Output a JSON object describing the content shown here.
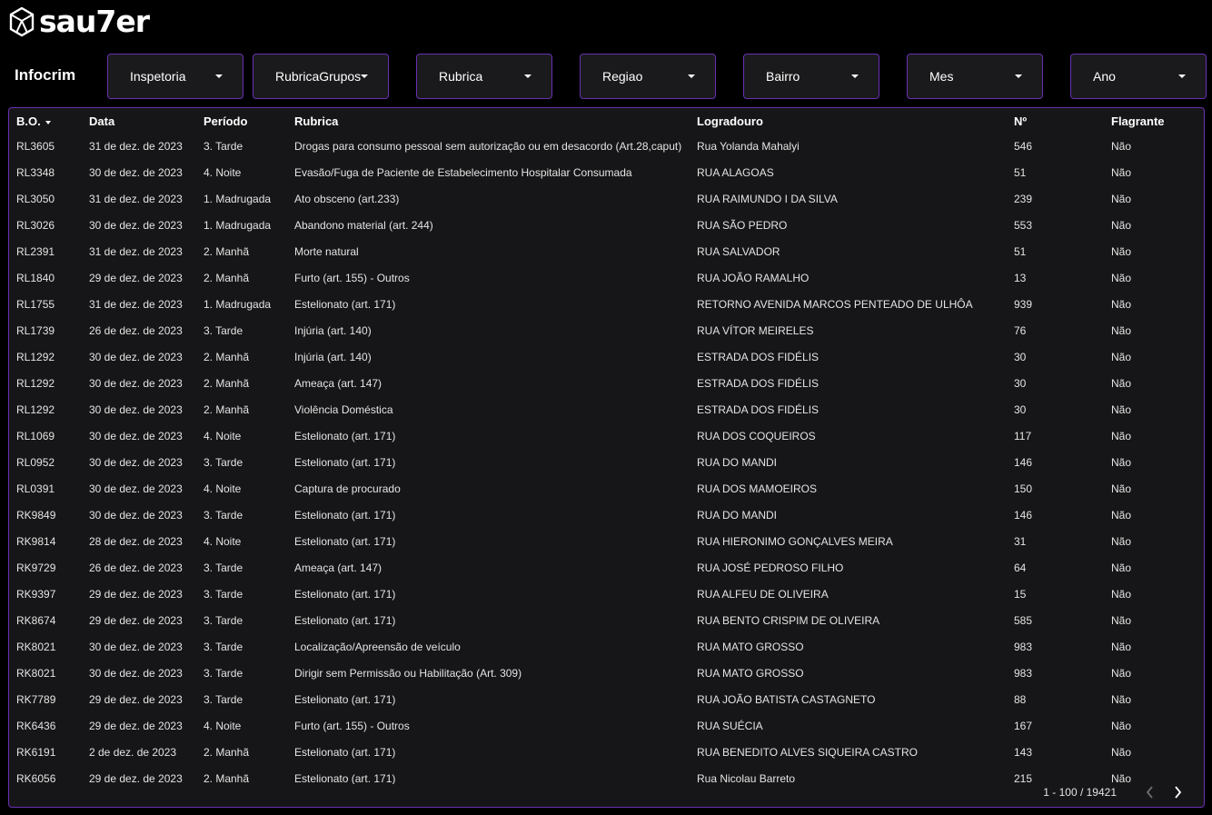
{
  "brand": {
    "name": "sau7er"
  },
  "page": {
    "title": "Infocrim"
  },
  "filters": [
    {
      "label": "Inspetoria"
    },
    {
      "label": "RubricaGrupos"
    },
    {
      "label": "Rubrica"
    },
    {
      "label": "Regiao"
    },
    {
      "label": "Bairro"
    },
    {
      "label": "Mes"
    },
    {
      "label": "Ano"
    }
  ],
  "table": {
    "headers": {
      "bo": "B.O.",
      "data": "Data",
      "periodo": "Período",
      "rubrica": "Rubrica",
      "logradouro": "Logradouro",
      "numero": "Nº",
      "flagrante": "Flagrante"
    },
    "sort": {
      "column": "bo",
      "direction": "desc"
    },
    "rows": [
      {
        "bo": "RL3605",
        "data": "31 de dez. de 2023",
        "periodo": "3. Tarde",
        "rubrica": "Drogas para consumo pessoal sem autorização ou em desacordo (Art.28,caput)",
        "logradouro": "Rua Yolanda Mahalyi",
        "numero": "546",
        "flagrante": "Não"
      },
      {
        "bo": "RL3348",
        "data": "30 de dez. de 2023",
        "periodo": "4. Noite",
        "rubrica": "Evasão/Fuga de Paciente de Estabelecimento Hospitalar Consumada",
        "logradouro": "RUA ALAGOAS",
        "numero": "51",
        "flagrante": "Não"
      },
      {
        "bo": "RL3050",
        "data": "31 de dez. de 2023",
        "periodo": "1. Madrugada",
        "rubrica": "Ato obsceno (art.233)",
        "logradouro": "RUA RAIMUNDO I DA SILVA",
        "numero": "239",
        "flagrante": "Não"
      },
      {
        "bo": "RL3026",
        "data": "30 de dez. de 2023",
        "periodo": "1. Madrugada",
        "rubrica": "Abandono material (art. 244)",
        "logradouro": "RUA SÃO PEDRO",
        "numero": "553",
        "flagrante": "Não"
      },
      {
        "bo": "RL2391",
        "data": "31 de dez. de 2023",
        "periodo": "2. Manhã",
        "rubrica": "Morte natural",
        "logradouro": "RUA SALVADOR",
        "numero": "51",
        "flagrante": "Não"
      },
      {
        "bo": "RL1840",
        "data": "29 de dez. de 2023",
        "periodo": "2. Manhã",
        "rubrica": "Furto (art. 155) - Outros",
        "logradouro": "RUA JOÃO RAMALHO",
        "numero": "13",
        "flagrante": "Não"
      },
      {
        "bo": "RL1755",
        "data": "31 de dez. de 2023",
        "periodo": "1. Madrugada",
        "rubrica": "Estelionato (art. 171)",
        "logradouro": "RETORNO AVENIDA MARCOS PENTEADO DE ULHÔA",
        "numero": "939",
        "flagrante": "Não"
      },
      {
        "bo": "RL1739",
        "data": "26 de dez. de 2023",
        "periodo": "3. Tarde",
        "rubrica": "Injúria (art. 140)",
        "logradouro": "RUA VÍTOR MEIRELES",
        "numero": "76",
        "flagrante": "Não"
      },
      {
        "bo": "RL1292",
        "data": "30 de dez. de 2023",
        "periodo": "2. Manhã",
        "rubrica": "Injúria (art. 140)",
        "logradouro": "ESTRADA DOS FIDÉLIS",
        "numero": "30",
        "flagrante": "Não"
      },
      {
        "bo": "RL1292",
        "data": "30 de dez. de 2023",
        "periodo": "2. Manhã",
        "rubrica": "Ameaça (art. 147)",
        "logradouro": "ESTRADA DOS FIDÉLIS",
        "numero": "30",
        "flagrante": "Não"
      },
      {
        "bo": "RL1292",
        "data": "30 de dez. de 2023",
        "periodo": "2. Manhã",
        "rubrica": "Violência Doméstica",
        "logradouro": "ESTRADA DOS FIDÉLIS",
        "numero": "30",
        "flagrante": "Não"
      },
      {
        "bo": "RL1069",
        "data": "30 de dez. de 2023",
        "periodo": "4. Noite",
        "rubrica": "Estelionato (art. 171)",
        "logradouro": "RUA DOS COQUEIROS",
        "numero": "117",
        "flagrante": "Não"
      },
      {
        "bo": "RL0952",
        "data": "30 de dez. de 2023",
        "periodo": "3. Tarde",
        "rubrica": "Estelionato (art. 171)",
        "logradouro": "RUA DO MANDI",
        "numero": "146",
        "flagrante": "Não"
      },
      {
        "bo": "RL0391",
        "data": "30 de dez. de 2023",
        "periodo": "4. Noite",
        "rubrica": "Captura de procurado",
        "logradouro": "RUA DOS MAMOEIROS",
        "numero": "150",
        "flagrante": "Não"
      },
      {
        "bo": "RK9849",
        "data": "30 de dez. de 2023",
        "periodo": "3. Tarde",
        "rubrica": "Estelionato (art. 171)",
        "logradouro": "RUA DO MANDI",
        "numero": "146",
        "flagrante": "Não"
      },
      {
        "bo": "RK9814",
        "data": "28 de dez. de 2023",
        "periodo": "4. Noite",
        "rubrica": "Estelionato (art. 171)",
        "logradouro": "RUA HIERONIMO GONÇALVES MEIRA",
        "numero": "31",
        "flagrante": "Não"
      },
      {
        "bo": "RK9729",
        "data": "26 de dez. de 2023",
        "periodo": "3. Tarde",
        "rubrica": "Ameaça (art. 147)",
        "logradouro": "RUA JOSÉ PEDROSO FILHO",
        "numero": "64",
        "flagrante": "Não"
      },
      {
        "bo": "RK9397",
        "data": "29 de dez. de 2023",
        "periodo": "3. Tarde",
        "rubrica": "Estelionato (art. 171)",
        "logradouro": "RUA ALFEU DE OLIVEIRA",
        "numero": "15",
        "flagrante": "Não"
      },
      {
        "bo": "RK8674",
        "data": "29 de dez. de 2023",
        "periodo": "3. Tarde",
        "rubrica": "Estelionato (art. 171)",
        "logradouro": "RUA BENTO CRISPIM DE OLIVEIRA",
        "numero": "585",
        "flagrante": "Não"
      },
      {
        "bo": "RK8021",
        "data": "30 de dez. de 2023",
        "periodo": "3. Tarde",
        "rubrica": "Localização/Apreensão de veículo",
        "logradouro": "RUA MATO GROSSO",
        "numero": "983",
        "flagrante": "Não"
      },
      {
        "bo": "RK8021",
        "data": "30 de dez. de 2023",
        "periodo": "3. Tarde",
        "rubrica": "Dirigir sem Permissão ou Habilitação (Art. 309)",
        "logradouro": "RUA MATO GROSSO",
        "numero": "983",
        "flagrante": "Não"
      },
      {
        "bo": "RK7789",
        "data": "29 de dez. de 2023",
        "periodo": "3. Tarde",
        "rubrica": "Estelionato (art. 171)",
        "logradouro": "RUA JOÃO BATISTA CASTAGNETO",
        "numero": "88",
        "flagrante": "Não"
      },
      {
        "bo": "RK6436",
        "data": "29 de dez. de 2023",
        "periodo": "4. Noite",
        "rubrica": "Furto (art. 155) - Outros",
        "logradouro": "RUA SUÉCIA",
        "numero": "167",
        "flagrante": "Não"
      },
      {
        "bo": "RK6191",
        "data": "2 de dez. de 2023",
        "periodo": "2. Manhã",
        "rubrica": "Estelionato (art. 171)",
        "logradouro": "RUA BENEDITO ALVES SIQUEIRA CASTRO",
        "numero": "143",
        "flagrante": "Não"
      },
      {
        "bo": "RK6056",
        "data": "29 de dez. de 2023",
        "periodo": "2. Manhã",
        "rubrica": "Estelionato (art. 171)",
        "logradouro": "Rua Nicolau Barreto",
        "numero": "215",
        "flagrante": "Não"
      }
    ]
  },
  "pagination": {
    "info": "1 - 100 / 19421"
  },
  "colors": {
    "accent": "#6a2fb3",
    "background": "#000000",
    "panel": "#161618",
    "text": "#e4e4e4"
  }
}
